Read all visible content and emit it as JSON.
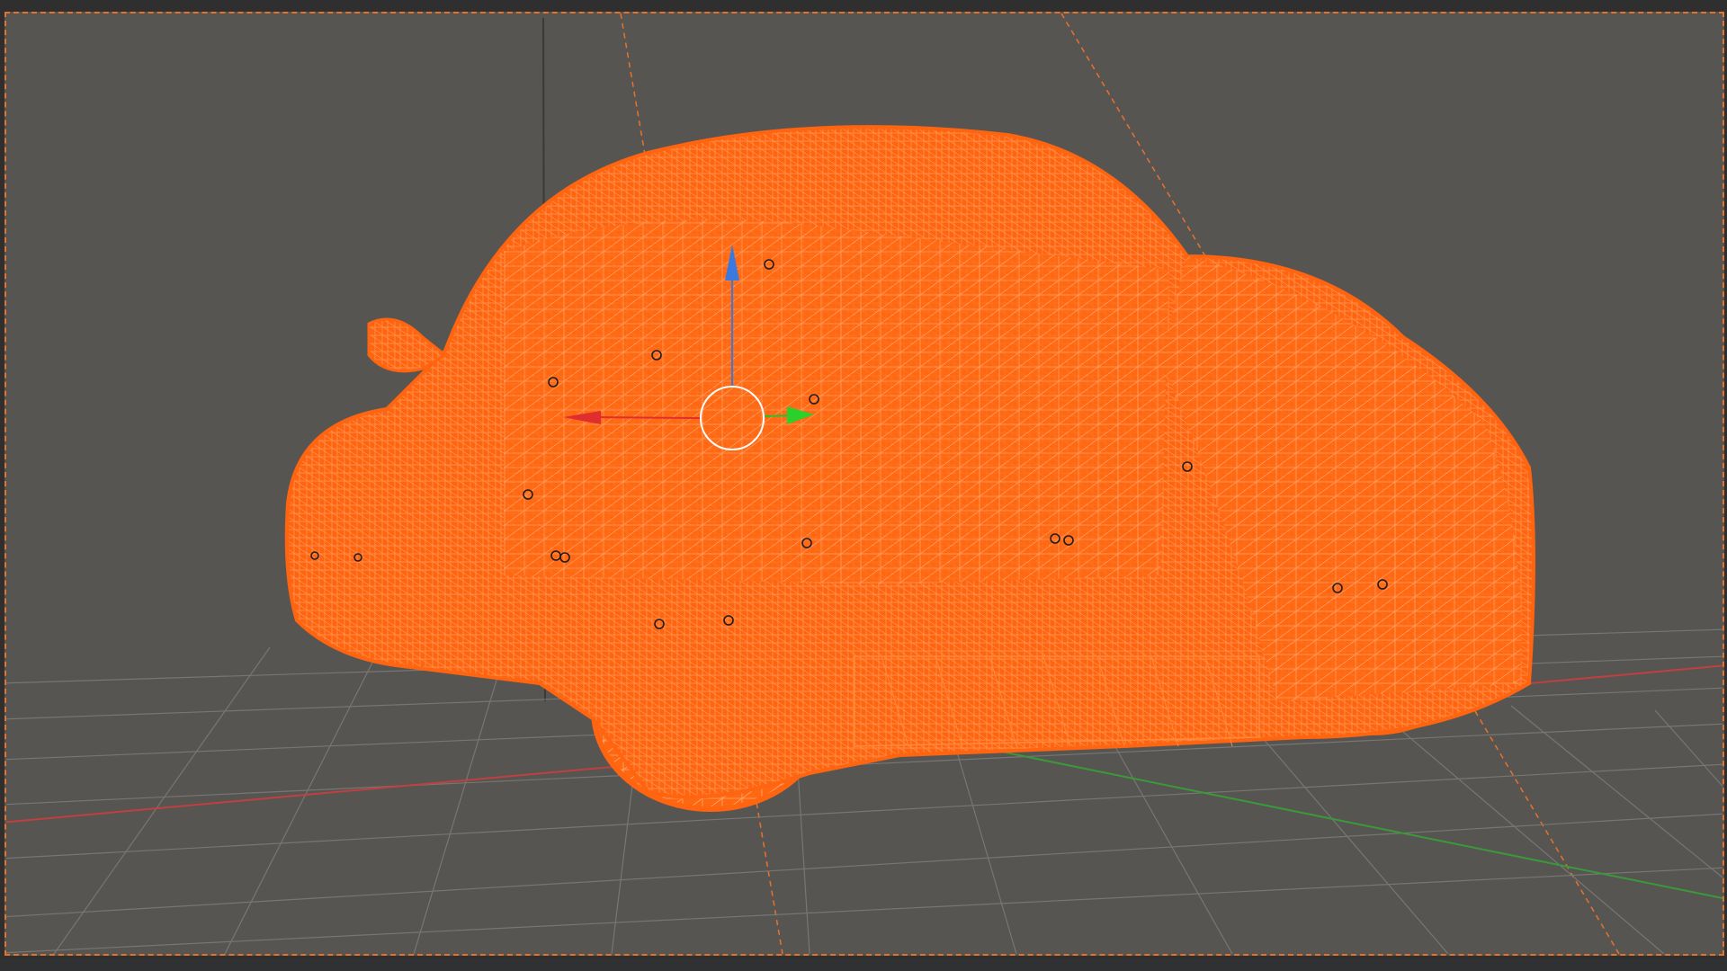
{
  "viewport": {
    "background_color": "#575552",
    "selection_color": "#ff6410",
    "grid_color": "#7a7a78",
    "x_axis_color": "#c04040",
    "y_axis_color": "#3a9a3a",
    "z_axis_color": "#3a7adf"
  },
  "scene": {
    "selected_object": "car-wireframe",
    "shading_mode": "wireframe"
  },
  "gizmo": {
    "type": "translate",
    "x_handle_icon": "arrow-red-icon",
    "y_handle_icon": "arrow-green-icon",
    "z_handle_icon": "arrow-blue-icon",
    "center_icon": "circle-ring-icon"
  }
}
